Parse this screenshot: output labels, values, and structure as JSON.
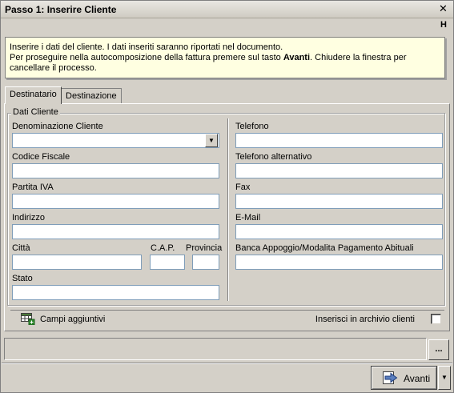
{
  "window": {
    "title": "Passo 1: Inserire Cliente",
    "close_glyph": "✕",
    "help_glyph": "H"
  },
  "info": {
    "line1": "Inserire i dati del cliente. I dati inseriti saranno riportati nel documento.",
    "line2a": "Per proseguire nella autocomposizione della fattura premere sul tasto ",
    "line2b": "Avanti",
    "line2c": ". Chiudere la finestra per",
    "line3": "cancellare il processo."
  },
  "tabs": [
    {
      "label": "Destinatario",
      "active": true
    },
    {
      "label": "Destinazione",
      "active": false
    }
  ],
  "group": {
    "label": "Dati Cliente"
  },
  "fields": {
    "denominazione": {
      "label": "Denominazione Cliente",
      "value": ""
    },
    "codice_fiscale": {
      "label": "Codice Fiscale",
      "value": ""
    },
    "partita_iva": {
      "label": "Partita IVA",
      "value": ""
    },
    "indirizzo": {
      "label": "Indirizzo",
      "value": ""
    },
    "citta": {
      "label": "Città",
      "value": ""
    },
    "cap": {
      "label": "C.A.P.",
      "value": ""
    },
    "provincia": {
      "label": "Provincia",
      "value": ""
    },
    "stato": {
      "label": "Stato",
      "value": ""
    },
    "telefono": {
      "label": "Telefono",
      "value": ""
    },
    "telefono_alt": {
      "label": "Telefono alternativo",
      "value": ""
    },
    "fax": {
      "label": "Fax",
      "value": ""
    },
    "email": {
      "label": "E-Mail",
      "value": ""
    },
    "banca": {
      "label": "Banca Appoggio/Modalita Pagamento Abituali",
      "value": ""
    }
  },
  "bottom": {
    "campi_label": "Campi aggiuntivi",
    "inserisci_label": "Inserisci in archivio clienti",
    "dots_label": "...",
    "avanti_label": "Avanti",
    "combo_arrow": "▼",
    "dropdown_arrow": "▼"
  },
  "colors": {
    "info_bg": "#ffffe1",
    "window_bg": "#d4d0c8"
  },
  "icons": {
    "campi": "table-add-icon",
    "avanti": "arrow-right-icon"
  }
}
